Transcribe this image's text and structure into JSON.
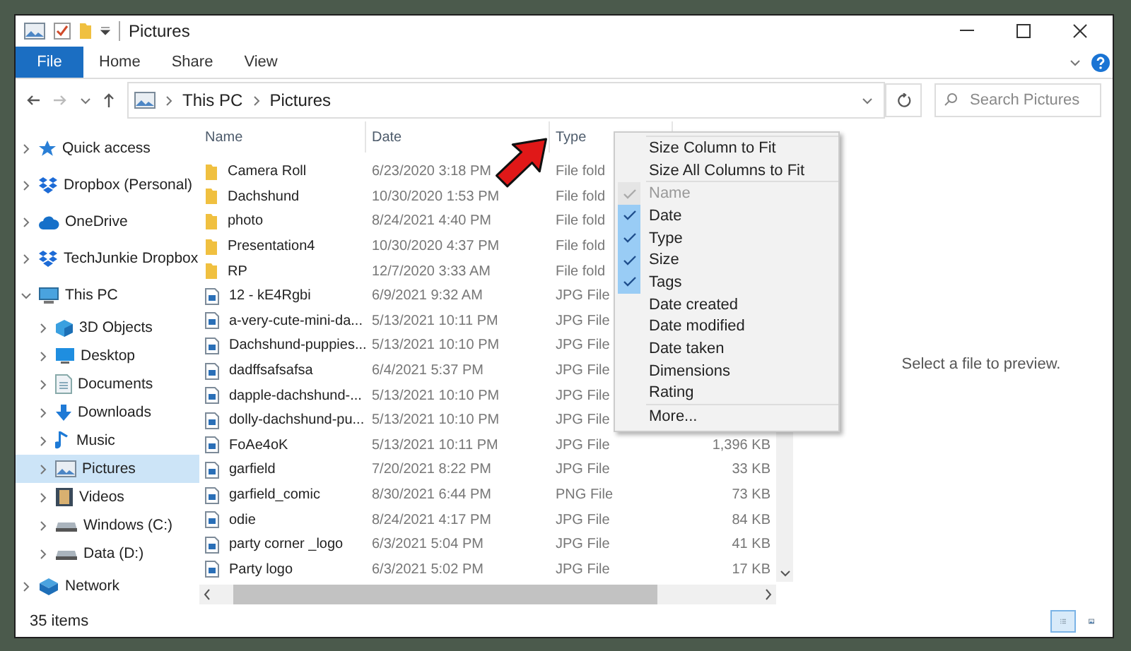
{
  "window": {
    "title": "Pictures"
  },
  "ribbon": {
    "tabs": [
      {
        "label": "File",
        "kind": "file"
      },
      {
        "label": "Home",
        "kind": "tab"
      },
      {
        "label": "Share",
        "kind": "tab"
      },
      {
        "label": "View",
        "kind": "tab"
      }
    ]
  },
  "address_bar": {
    "breadcrumbs": [
      "This PC",
      "Pictures"
    ],
    "search": {
      "placeholder": "Search Pictures"
    }
  },
  "navigation": {
    "items": [
      {
        "label": "Quick access",
        "kind": "star",
        "expanded": false,
        "selected": false
      },
      {
        "label": "Dropbox (Personal)",
        "kind": "dropbox",
        "expanded": false,
        "selected": false
      },
      {
        "label": "OneDrive",
        "kind": "cloud",
        "expanded": false,
        "selected": false
      },
      {
        "label": "TechJunkie Dropbox",
        "kind": "dropbox",
        "expanded": false,
        "selected": false
      },
      {
        "label": "This PC",
        "kind": "pc",
        "expanded": true,
        "selected": false,
        "children": [
          {
            "label": "3D Objects",
            "kind": "cube",
            "expanded": false,
            "selected": false
          },
          {
            "label": "Desktop",
            "kind": "desktop",
            "expanded": false,
            "selected": false
          },
          {
            "label": "Documents",
            "kind": "document",
            "expanded": false,
            "selected": false
          },
          {
            "label": "Downloads",
            "kind": "download",
            "expanded": false,
            "selected": false
          },
          {
            "label": "Music",
            "kind": "music",
            "expanded": false,
            "selected": false
          },
          {
            "label": "Pictures",
            "kind": "pictures",
            "expanded": false,
            "selected": true
          },
          {
            "label": "Videos",
            "kind": "film",
            "expanded": false,
            "selected": false
          },
          {
            "label": "Windows (C:)",
            "kind": "drive",
            "expanded": false,
            "selected": false
          },
          {
            "label": "Data (D:)",
            "kind": "drive",
            "expanded": false,
            "selected": false
          }
        ]
      },
      {
        "label": "Network",
        "kind": "network",
        "expanded": false,
        "selected": false
      }
    ]
  },
  "file_list": {
    "columns": [
      "Name",
      "Date",
      "Type"
    ],
    "rows": [
      {
        "name": "Camera Roll",
        "kind": "folder",
        "date": "6/23/2020 3:18 PM",
        "type": "File fold"
      },
      {
        "name": "Dachshund",
        "kind": "folder",
        "date": "10/30/2020 1:53 PM",
        "type": "File fold"
      },
      {
        "name": "photo",
        "kind": "folder",
        "date": "8/24/2021 4:40 PM",
        "type": "File fold"
      },
      {
        "name": "Presentation4",
        "kind": "folder",
        "date": "10/30/2020 4:37 PM",
        "type": "File fold"
      },
      {
        "name": "RP",
        "kind": "folder",
        "date": "12/7/2020 3:33 AM",
        "type": "File fold"
      },
      {
        "name": "12 - kE4Rgbi",
        "kind": "image",
        "date": "6/9/2021 9:32 AM",
        "type": "JPG File"
      },
      {
        "name": "a-very-cute-mini-da...",
        "kind": "image",
        "date": "5/13/2021 10:11 PM",
        "type": "JPG File"
      },
      {
        "name": "Dachshund-puppies...",
        "kind": "image",
        "date": "5/13/2021 10:10 PM",
        "type": "JPG File"
      },
      {
        "name": "dadffsafsafsa",
        "kind": "image",
        "date": "6/4/2021 5:37 PM",
        "type": "JPG File"
      },
      {
        "name": "dapple-dachshund-...",
        "kind": "image",
        "date": "5/13/2021 10:10 PM",
        "type": "JPG File"
      },
      {
        "name": "dolly-dachshund-pu...",
        "kind": "image",
        "date": "5/13/2021 10:10 PM",
        "type": "JPG File"
      },
      {
        "name": "FoAe4oK",
        "kind": "image",
        "date": "5/13/2021 10:11 PM",
        "type": "JPG File",
        "size": "1,396 KB"
      },
      {
        "name": "garfield",
        "kind": "image",
        "date": "7/20/2021 8:22 PM",
        "type": "JPG File",
        "size": "33 KB"
      },
      {
        "name": "garfield_comic",
        "kind": "image",
        "date": "8/30/2021 6:44 PM",
        "type": "PNG File",
        "size": "73 KB"
      },
      {
        "name": "odie",
        "kind": "image",
        "date": "8/24/2021 4:17 PM",
        "type": "JPG File",
        "size": "84 KB"
      },
      {
        "name": "party corner _logo",
        "kind": "image",
        "date": "6/3/2021 5:04 PM",
        "type": "JPG File",
        "size": "41 KB"
      },
      {
        "name": "Party logo",
        "kind": "image",
        "date": "6/3/2021 5:02 PM",
        "type": "JPG File",
        "size": "17 KB"
      }
    ]
  },
  "context_menu": {
    "groups": [
      [
        {
          "label": "Size Column to Fit",
          "checked": false,
          "disabled": false
        },
        {
          "label": "Size All Columns to Fit",
          "checked": false,
          "disabled": false
        }
      ],
      [
        {
          "label": "Name",
          "checked": true,
          "disabled": true
        },
        {
          "label": "Date",
          "checked": true,
          "disabled": false
        },
        {
          "label": "Type",
          "checked": true,
          "disabled": false
        },
        {
          "label": "Size",
          "checked": true,
          "disabled": false
        },
        {
          "label": "Tags",
          "checked": true,
          "disabled": false
        },
        {
          "label": "Date created",
          "checked": false,
          "disabled": false
        },
        {
          "label": "Date modified",
          "checked": false,
          "disabled": false
        },
        {
          "label": "Date taken",
          "checked": false,
          "disabled": false
        },
        {
          "label": "Dimensions",
          "checked": false,
          "disabled": false
        },
        {
          "label": "Rating",
          "checked": false,
          "disabled": false
        }
      ],
      [
        {
          "label": "More...",
          "checked": false,
          "disabled": false
        }
      ]
    ]
  },
  "preview": {
    "message": "Select a file to preview."
  },
  "status_bar": {
    "item_count": "35 items",
    "views": [
      {
        "kind": "details",
        "selected": true
      },
      {
        "kind": "icons",
        "selected": false
      }
    ]
  }
}
